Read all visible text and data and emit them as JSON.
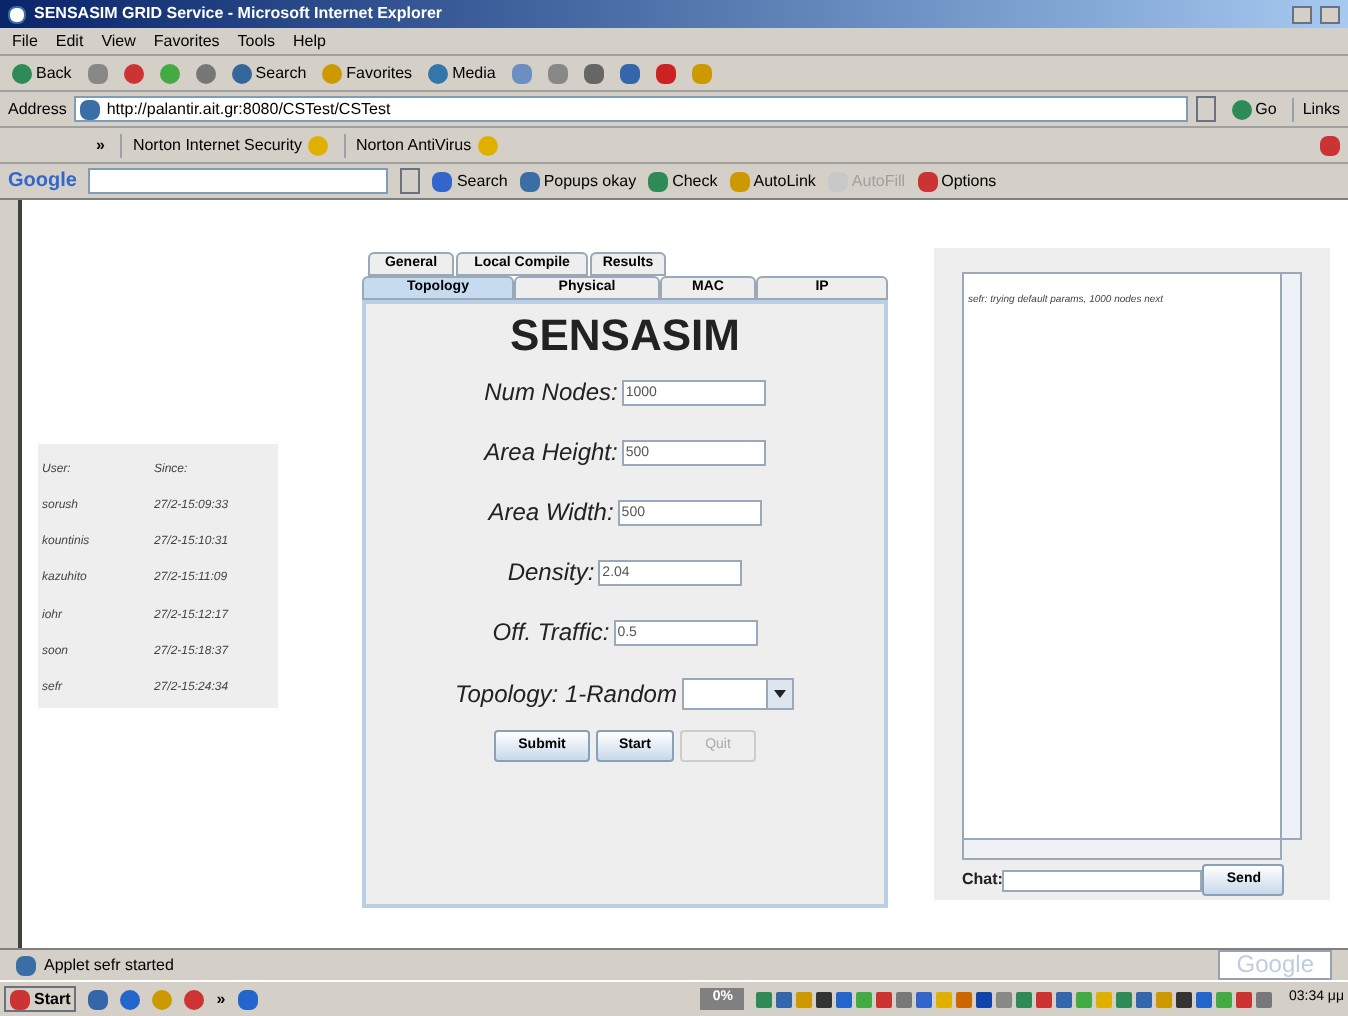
{
  "window": {
    "title": "SENSASIM GRID Service - Microsoft Internet Explorer"
  },
  "menu": [
    "File",
    "Edit",
    "View",
    "Favorites",
    "Tools",
    "Help"
  ],
  "toolbar": [
    "Back",
    "Search",
    "Favorites",
    "Media"
  ],
  "address": {
    "label": "Address",
    "value": "http://palantir.ait.gr:8080/CSTest/CSTest",
    "go": "Go",
    "links": "Links"
  },
  "norton_bar": {
    "chevron": "»",
    "items": [
      "Norton Internet Security",
      "Norton AntiVirus"
    ]
  },
  "google_bar": {
    "logo": "Google",
    "items": [
      {
        "label": "Search",
        "disabled": false
      },
      {
        "label": "Popups okay",
        "disabled": false
      },
      {
        "label": "Check",
        "disabled": false
      },
      {
        "label": "AutoLink",
        "disabled": false
      },
      {
        "label": "AutoFill",
        "disabled": true
      },
      {
        "label": "Options",
        "disabled": false
      }
    ]
  },
  "users": {
    "columns": [
      "User:",
      "Since:"
    ],
    "rows": [
      [
        "sorush",
        "27/2-15:09:33"
      ],
      [
        "kountinis",
        "27/2-15:10:31"
      ],
      [
        "kazuhito",
        "27/2-15:11:09"
      ],
      [
        "iohr",
        "27/2-15:12:17"
      ],
      [
        "soon",
        "27/2-15:18:37"
      ],
      [
        "sefr",
        "27/2-15:24:34"
      ]
    ]
  },
  "applet": {
    "tab_rows": [
      [
        {
          "label": "General",
          "selected": false
        },
        {
          "label": "Local Compile",
          "selected": false
        },
        {
          "label": "Results",
          "selected": false
        }
      ],
      [
        {
          "label": "Topology",
          "selected": true
        },
        {
          "label": "Physical",
          "selected": false
        },
        {
          "label": "MAC",
          "selected": false
        },
        {
          "label": "IP",
          "selected": false
        }
      ]
    ],
    "title": "SENSASIM",
    "fields": [
      {
        "label": "Num Nodes:",
        "value": "1000"
      },
      {
        "label": "Area Height:",
        "value": "500"
      },
      {
        "label": "Area Width:",
        "value": "500"
      },
      {
        "label": "Density:",
        "value": "2.04"
      },
      {
        "label": "Off. Traffic:",
        "value": "0.5"
      }
    ],
    "topology": {
      "label": "Topology: 1-Random"
    },
    "buttons": [
      {
        "label": "Submit",
        "disabled": false
      },
      {
        "label": "Start",
        "disabled": false
      },
      {
        "label": "Quit",
        "disabled": true
      }
    ]
  },
  "chat": {
    "messages": [
      "sefr: trying default params, 1000 nodes next"
    ],
    "label": "Chat:",
    "send": "Send"
  },
  "status_bar": {
    "text": "Applet sefr started",
    "google": "Google"
  },
  "taskbar": {
    "start": "Start",
    "chevron": "»",
    "progress": "0%",
    "clock": "03:34 μμ"
  }
}
